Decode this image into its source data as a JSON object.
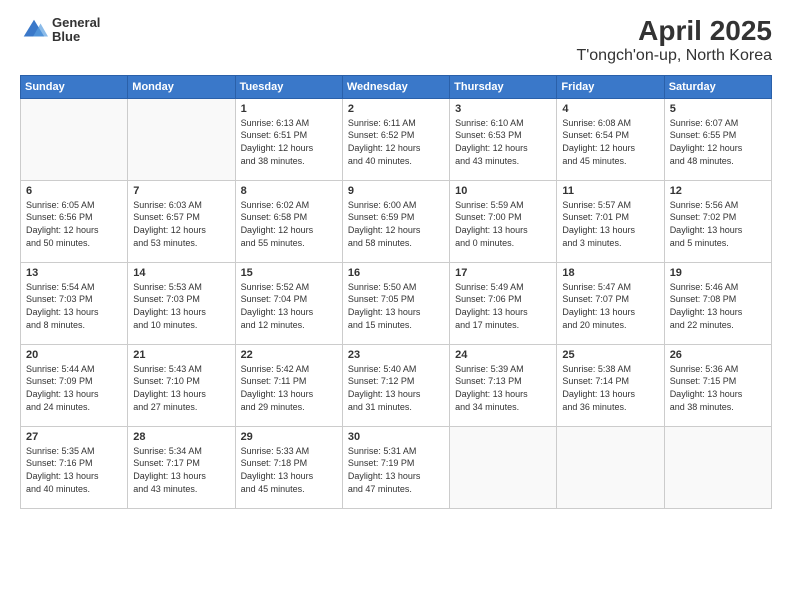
{
  "logo": {
    "line1": "General",
    "line2": "Blue"
  },
  "title": "April 2025",
  "subtitle": "T'ongch'on-up, North Korea",
  "weekdays": [
    "Sunday",
    "Monday",
    "Tuesday",
    "Wednesday",
    "Thursday",
    "Friday",
    "Saturday"
  ],
  "weeks": [
    [
      {
        "day": "",
        "info": ""
      },
      {
        "day": "",
        "info": ""
      },
      {
        "day": "1",
        "info": "Sunrise: 6:13 AM\nSunset: 6:51 PM\nDaylight: 12 hours\nand 38 minutes."
      },
      {
        "day": "2",
        "info": "Sunrise: 6:11 AM\nSunset: 6:52 PM\nDaylight: 12 hours\nand 40 minutes."
      },
      {
        "day": "3",
        "info": "Sunrise: 6:10 AM\nSunset: 6:53 PM\nDaylight: 12 hours\nand 43 minutes."
      },
      {
        "day": "4",
        "info": "Sunrise: 6:08 AM\nSunset: 6:54 PM\nDaylight: 12 hours\nand 45 minutes."
      },
      {
        "day": "5",
        "info": "Sunrise: 6:07 AM\nSunset: 6:55 PM\nDaylight: 12 hours\nand 48 minutes."
      }
    ],
    [
      {
        "day": "6",
        "info": "Sunrise: 6:05 AM\nSunset: 6:56 PM\nDaylight: 12 hours\nand 50 minutes."
      },
      {
        "day": "7",
        "info": "Sunrise: 6:03 AM\nSunset: 6:57 PM\nDaylight: 12 hours\nand 53 minutes."
      },
      {
        "day": "8",
        "info": "Sunrise: 6:02 AM\nSunset: 6:58 PM\nDaylight: 12 hours\nand 55 minutes."
      },
      {
        "day": "9",
        "info": "Sunrise: 6:00 AM\nSunset: 6:59 PM\nDaylight: 12 hours\nand 58 minutes."
      },
      {
        "day": "10",
        "info": "Sunrise: 5:59 AM\nSunset: 7:00 PM\nDaylight: 13 hours\nand 0 minutes."
      },
      {
        "day": "11",
        "info": "Sunrise: 5:57 AM\nSunset: 7:01 PM\nDaylight: 13 hours\nand 3 minutes."
      },
      {
        "day": "12",
        "info": "Sunrise: 5:56 AM\nSunset: 7:02 PM\nDaylight: 13 hours\nand 5 minutes."
      }
    ],
    [
      {
        "day": "13",
        "info": "Sunrise: 5:54 AM\nSunset: 7:03 PM\nDaylight: 13 hours\nand 8 minutes."
      },
      {
        "day": "14",
        "info": "Sunrise: 5:53 AM\nSunset: 7:03 PM\nDaylight: 13 hours\nand 10 minutes."
      },
      {
        "day": "15",
        "info": "Sunrise: 5:52 AM\nSunset: 7:04 PM\nDaylight: 13 hours\nand 12 minutes."
      },
      {
        "day": "16",
        "info": "Sunrise: 5:50 AM\nSunset: 7:05 PM\nDaylight: 13 hours\nand 15 minutes."
      },
      {
        "day": "17",
        "info": "Sunrise: 5:49 AM\nSunset: 7:06 PM\nDaylight: 13 hours\nand 17 minutes."
      },
      {
        "day": "18",
        "info": "Sunrise: 5:47 AM\nSunset: 7:07 PM\nDaylight: 13 hours\nand 20 minutes."
      },
      {
        "day": "19",
        "info": "Sunrise: 5:46 AM\nSunset: 7:08 PM\nDaylight: 13 hours\nand 22 minutes."
      }
    ],
    [
      {
        "day": "20",
        "info": "Sunrise: 5:44 AM\nSunset: 7:09 PM\nDaylight: 13 hours\nand 24 minutes."
      },
      {
        "day": "21",
        "info": "Sunrise: 5:43 AM\nSunset: 7:10 PM\nDaylight: 13 hours\nand 27 minutes."
      },
      {
        "day": "22",
        "info": "Sunrise: 5:42 AM\nSunset: 7:11 PM\nDaylight: 13 hours\nand 29 minutes."
      },
      {
        "day": "23",
        "info": "Sunrise: 5:40 AM\nSunset: 7:12 PM\nDaylight: 13 hours\nand 31 minutes."
      },
      {
        "day": "24",
        "info": "Sunrise: 5:39 AM\nSunset: 7:13 PM\nDaylight: 13 hours\nand 34 minutes."
      },
      {
        "day": "25",
        "info": "Sunrise: 5:38 AM\nSunset: 7:14 PM\nDaylight: 13 hours\nand 36 minutes."
      },
      {
        "day": "26",
        "info": "Sunrise: 5:36 AM\nSunset: 7:15 PM\nDaylight: 13 hours\nand 38 minutes."
      }
    ],
    [
      {
        "day": "27",
        "info": "Sunrise: 5:35 AM\nSunset: 7:16 PM\nDaylight: 13 hours\nand 40 minutes."
      },
      {
        "day": "28",
        "info": "Sunrise: 5:34 AM\nSunset: 7:17 PM\nDaylight: 13 hours\nand 43 minutes."
      },
      {
        "day": "29",
        "info": "Sunrise: 5:33 AM\nSunset: 7:18 PM\nDaylight: 13 hours\nand 45 minutes."
      },
      {
        "day": "30",
        "info": "Sunrise: 5:31 AM\nSunset: 7:19 PM\nDaylight: 13 hours\nand 47 minutes."
      },
      {
        "day": "",
        "info": ""
      },
      {
        "day": "",
        "info": ""
      },
      {
        "day": "",
        "info": ""
      }
    ]
  ]
}
